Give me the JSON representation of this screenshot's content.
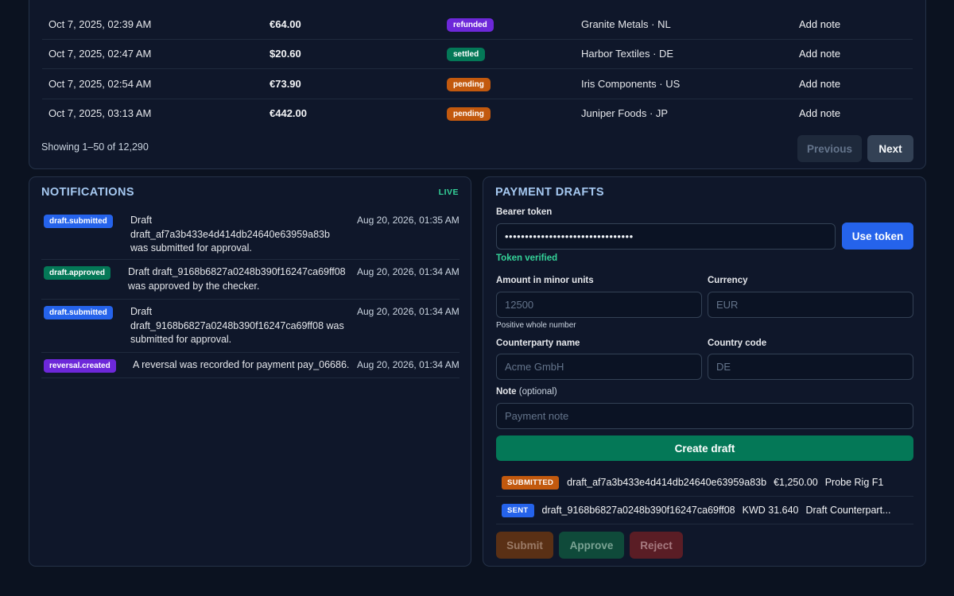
{
  "transactions": {
    "rows": [
      {
        "date": "Oct 7, 2025, 02:39 AM",
        "amount": "€64.00",
        "status": "refunded",
        "counterparty": "Granite Metals · NL",
        "note": "Add note"
      },
      {
        "date": "Oct 7, 2025, 02:47 AM",
        "amount": "$20.60",
        "status": "settled",
        "counterparty": "Harbor Textiles · DE",
        "note": "Add note"
      },
      {
        "date": "Oct 7, 2025, 02:54 AM",
        "amount": "€73.90",
        "status": "pending",
        "counterparty": "Iris Components · US",
        "note": "Add note"
      },
      {
        "date": "Oct 7, 2025, 03:13 AM",
        "amount": "€442.00",
        "status": "pending",
        "counterparty": "Juniper Foods · JP",
        "note": "Add note"
      }
    ],
    "showing": "Showing 1–50 of 12,290",
    "prev_label": "Previous",
    "next_label": "Next"
  },
  "notifications": {
    "title": "NOTIFICATIONS",
    "live": "LIVE",
    "items": [
      {
        "tag": "draft.submitted",
        "lines": [
          "Draft",
          "draft_af7a3b433e4d414db24640e63959a83b",
          "was submitted for approval."
        ],
        "time": "Aug 20, 2026, 01:35 AM"
      },
      {
        "tag": "draft.approved",
        "lines": [
          "Draft draft_9168b6827a0248b390f16247ca69ff08",
          "was approved by the checker."
        ],
        "time": "Aug 20, 2026, 01:34 AM"
      },
      {
        "tag": "draft.submitted",
        "lines": [
          "Draft",
          "draft_9168b6827a0248b390f16247ca69ff08 was",
          "submitted for approval."
        ],
        "time": "Aug 20, 2026, 01:34 AM"
      },
      {
        "tag": "reversal.created",
        "lines": [
          "A reversal was recorded for payment pay_06686."
        ],
        "time": "Aug 20, 2026, 01:34 AM"
      }
    ]
  },
  "drafts": {
    "title": "PAYMENT DRAFTS",
    "bearer_label": "Bearer token",
    "bearer_value": "••••••••••••••••••••••••••••••••",
    "use_token": "Use token",
    "token_verified": "Token verified",
    "amount_label": "Amount in minor units",
    "amount_placeholder": "12500",
    "amount_hint": "Positive whole number",
    "currency_label": "Currency",
    "currency_placeholder": "EUR",
    "counterparty_label": "Counterparty name",
    "counterparty_placeholder": "Acme GmbH",
    "country_label": "Country code",
    "country_placeholder": "DE",
    "note_label": "Note",
    "note_optional": "(optional)",
    "note_placeholder": "Payment note",
    "create_label": "Create draft",
    "list": [
      {
        "status": "SUBMITTED",
        "id": "draft_af7a3b433e4d414db24640e63959a83b",
        "amount": "€1,250.00",
        "name": "Probe Rig F1"
      },
      {
        "status": "SENT",
        "id": "draft_9168b6827a0248b390f16247ca69ff08",
        "amount": "KWD 31.640",
        "name": "Draft Counterpart..."
      }
    ],
    "submit_label": "Submit",
    "approve_label": "Approve",
    "reject_label": "Reject"
  }
}
